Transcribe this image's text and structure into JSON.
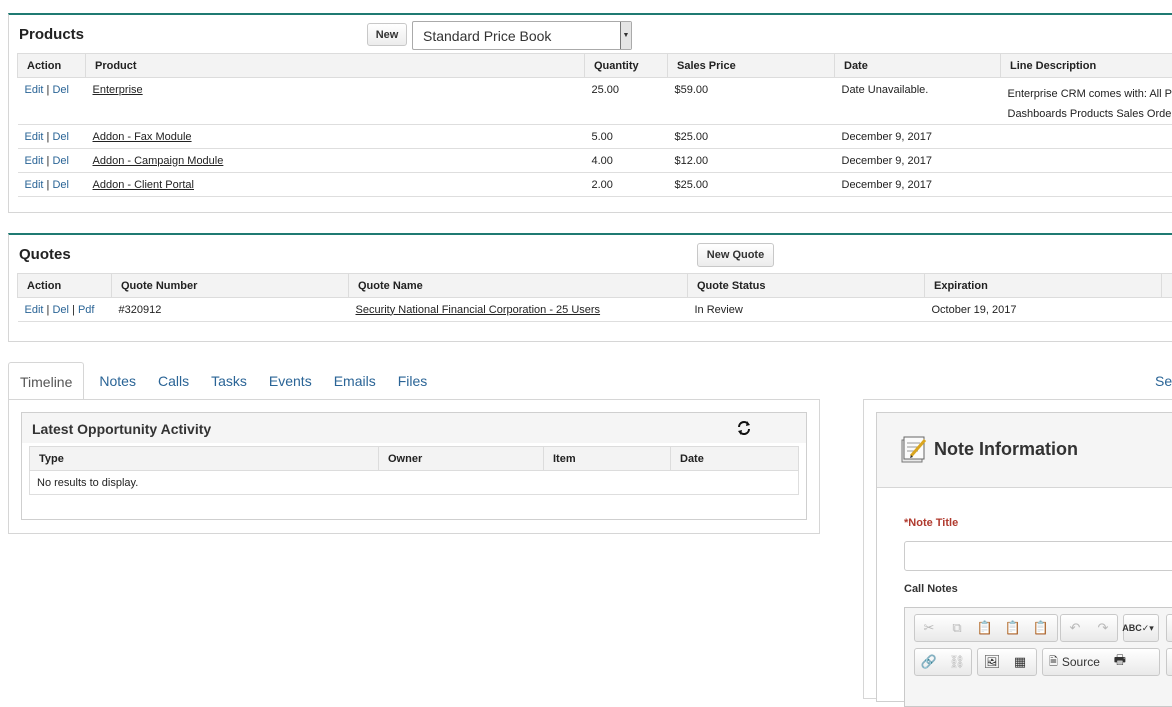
{
  "products": {
    "title": "Products",
    "new_label": "New",
    "price_book": "Standard Price Book",
    "headers": [
      "Action",
      "Product",
      "Quantity",
      "Sales Price",
      "Date",
      "Line Description"
    ],
    "rows": [
      {
        "product": "Enterprise",
        "quantity": "25.00",
        "price": "$59.00",
        "date": "Date Unavailable.",
        "desc1": "Enterprise CRM comes with: All Pr",
        "desc2": "Dashboards Products Sales Orde"
      },
      {
        "product": "Addon - Fax Module",
        "quantity": "5.00",
        "price": "$25.00",
        "date": "December 9, 2017",
        "desc1": "",
        "desc2": ""
      },
      {
        "product": "Addon - Campaign Module",
        "quantity": "4.00",
        "price": "$12.00",
        "date": "December 9, 2017",
        "desc1": "",
        "desc2": ""
      },
      {
        "product": "Addon - Client Portal",
        "quantity": "2.00",
        "price": "$25.00",
        "date": "December 9, 2017",
        "desc1": "",
        "desc2": ""
      }
    ]
  },
  "actions": {
    "edit": "Edit",
    "del": "Del",
    "pdf": "Pdf",
    "sep": "|"
  },
  "quotes": {
    "title": "Quotes",
    "new_label": "New Quote",
    "headers": [
      "Action",
      "Quote Number",
      "Quote Name",
      "Quote Status",
      "Expiration"
    ],
    "rows": [
      {
        "number": "#320912",
        "name": "Security National Financial Corporation - 25 Users",
        "status": "In Review",
        "expiration": "October 19, 2017"
      }
    ]
  },
  "tabs": [
    "Timeline",
    "Notes",
    "Calls",
    "Tasks",
    "Events",
    "Emails",
    "Files"
  ],
  "tabs_right_partial": "Se",
  "activity": {
    "title": "Latest Opportunity Activity",
    "headers": [
      "Type",
      "Owner",
      "Item",
      "Date"
    ],
    "empty": "No results to display."
  },
  "note": {
    "title": "Note Information",
    "title_label": "*Note Title",
    "title_value": "",
    "notes_label": "Call Notes",
    "source_label": "Source"
  },
  "colors": {
    "accent_border": "#1f7a72",
    "link": "#2a6496",
    "required": "#b03a2e"
  }
}
